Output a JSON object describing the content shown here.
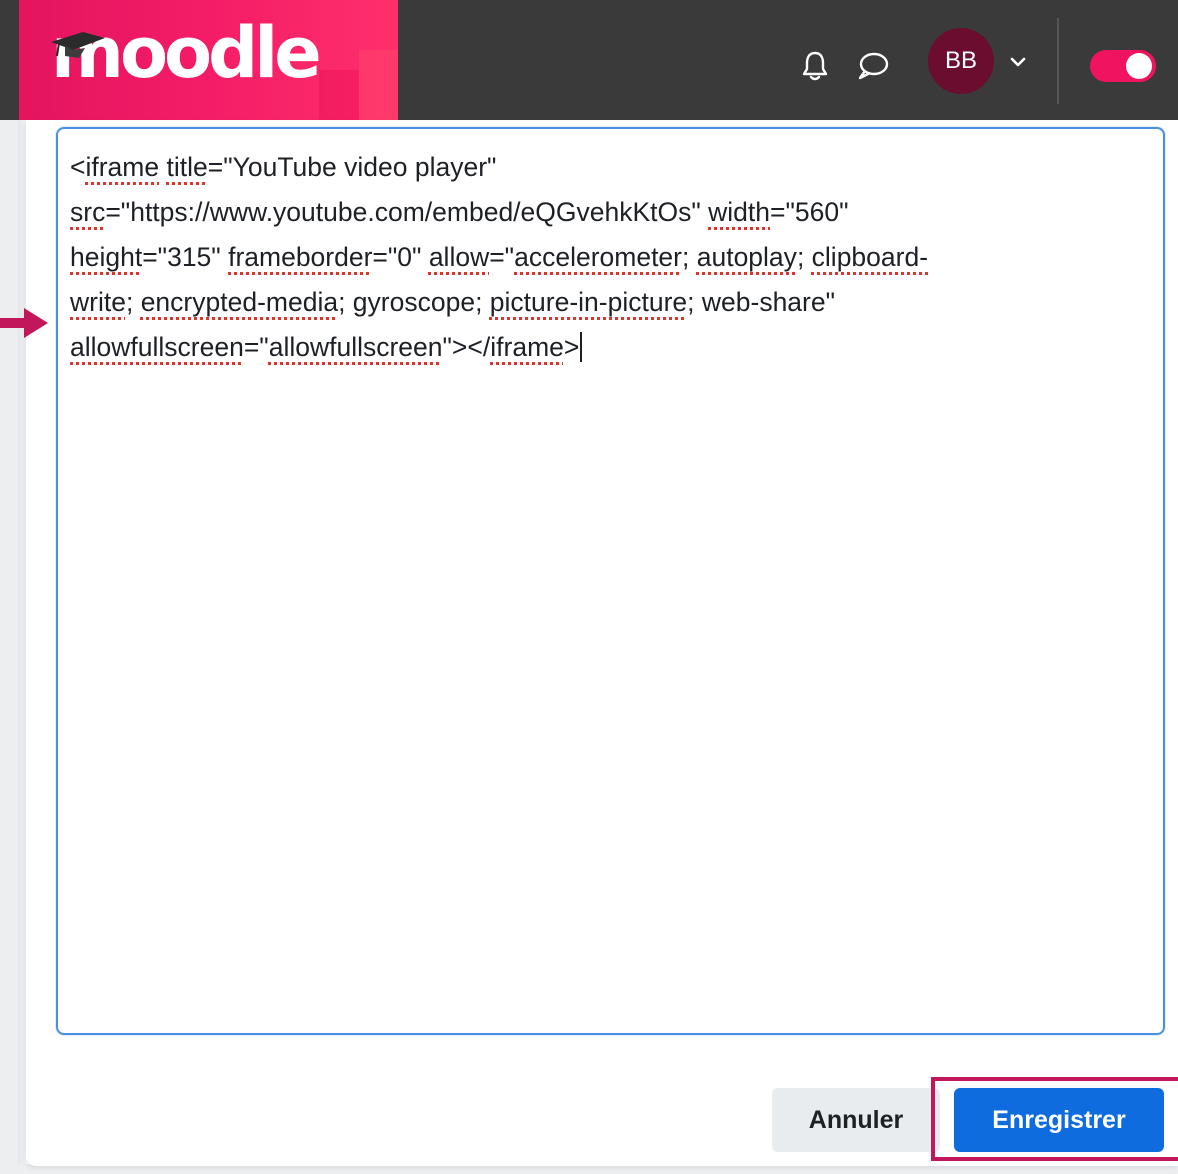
{
  "navbar": {
    "logo_text": "moodle",
    "avatar_initials": "BB",
    "icons": [
      "bell-icon",
      "chat-bubble-icon",
      "chevron-down-icon"
    ],
    "toggle_state": "on",
    "brand_color": "#f21665",
    "bar_color": "#3a3a3a"
  },
  "editor": {
    "lines": [
      {
        "segments": [
          {
            "t": "<"
          },
          {
            "t": "iframe",
            "s": true
          },
          {
            "t": " "
          },
          {
            "t": "title",
            "s": true
          },
          {
            "t": "=\"YouTube video player\""
          }
        ]
      },
      {
        "segments": [
          {
            "t": "src",
            "s": true
          },
          {
            "t": "=\"https://www.youtube.com/embed/eQGvehkKtOs\" "
          },
          {
            "t": "width",
            "s": true
          },
          {
            "t": "=\"560\""
          }
        ]
      },
      {
        "segments": [
          {
            "t": "height",
            "s": true
          },
          {
            "t": "=\"315\" "
          },
          {
            "t": "frameborder",
            "s": true
          },
          {
            "t": "=\"0\" "
          },
          {
            "t": "allow",
            "s": true
          },
          {
            "t": "=\""
          },
          {
            "t": "accelerometer",
            "s": true
          },
          {
            "t": "; "
          },
          {
            "t": "autoplay",
            "s": true
          },
          {
            "t": "; "
          },
          {
            "t": "clipboard-",
            "s": true
          }
        ]
      },
      {
        "segments": [
          {
            "t": "write",
            "s": true
          },
          {
            "t": "; "
          },
          {
            "t": "encrypted-media",
            "s": true
          },
          {
            "t": "; gyroscope; "
          },
          {
            "t": "picture-in-picture",
            "s": true
          },
          {
            "t": "; web-share\""
          }
        ]
      },
      {
        "segments": [
          {
            "t": "allowfullscreen",
            "s": true
          },
          {
            "t": "=\""
          },
          {
            "t": "allowfullscreen",
            "s": true
          },
          {
            "t": "\"></"
          },
          {
            "t": "iframe",
            "s": true
          },
          {
            "t": ">"
          }
        ]
      }
    ]
  },
  "footer": {
    "cancel_label": "Annuler",
    "save_label": "Enregistrer",
    "save_color": "#0f6cdf",
    "highlight_color": "#c2185b"
  }
}
